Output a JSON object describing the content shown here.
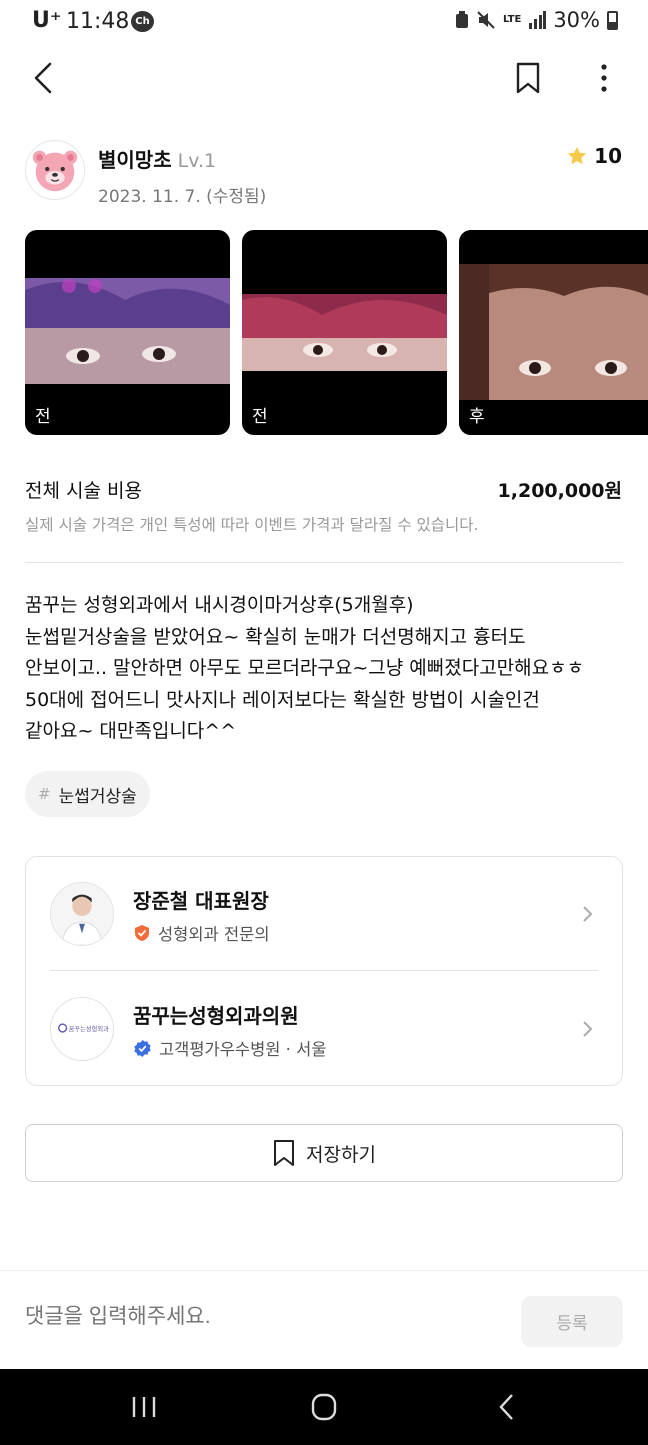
{
  "status_bar": {
    "carrier": "U⁺",
    "time": "11:48",
    "ch_badge": "Ch",
    "network": "LTE",
    "battery": "30%"
  },
  "author": {
    "name": "별이망초",
    "level": "Lv.1",
    "date": "2023. 11. 7. (수정됨)",
    "rating": "10"
  },
  "photos": [
    {
      "label": "전"
    },
    {
      "label": "전"
    },
    {
      "label": "후"
    }
  ],
  "cost": {
    "title": "전체 시술 비용",
    "value": "1,200,000원",
    "note": "실제 시술 가격은 개인 특성에 따라 이벤트 가격과 달라질 수 있습니다."
  },
  "review": {
    "lines": [
      "꿈꾸는 성형외과에서 내시경이마거상후(5개월후)",
      "눈썹밑거상술을 받았어요~ 확실히 눈매가 더선명해지고 흉터도",
      "안보이고.. 말안하면 아무도 모르더라구요~그냥 예뻐졌다고만해요ㅎㅎ",
      "50대에 접어드니 맛사지나 레이저보다는 확실한 방법이 시술인건",
      "같아요~ 대만족입니다^^"
    ]
  },
  "tag": {
    "hash": "#",
    "label": "눈썹거상술"
  },
  "doctor": {
    "name": "장준철 대표원장",
    "specialty": "성형외과 전문의"
  },
  "hospital": {
    "name": "꿈꾸는성형외과의원",
    "logo_text": "꿈꾸는성형외과",
    "badge": "고객평가우수병원 · 서울"
  },
  "save_button": {
    "label": "저장하기"
  },
  "comment": {
    "placeholder": "댓글을 입력해주세요.",
    "submit_label": "등록"
  },
  "colors": {
    "star": "#f7c948",
    "specialist_badge": "#f26b3a",
    "verified_badge": "#3b6fe0",
    "avatar_bg": "#f4a6b4"
  }
}
